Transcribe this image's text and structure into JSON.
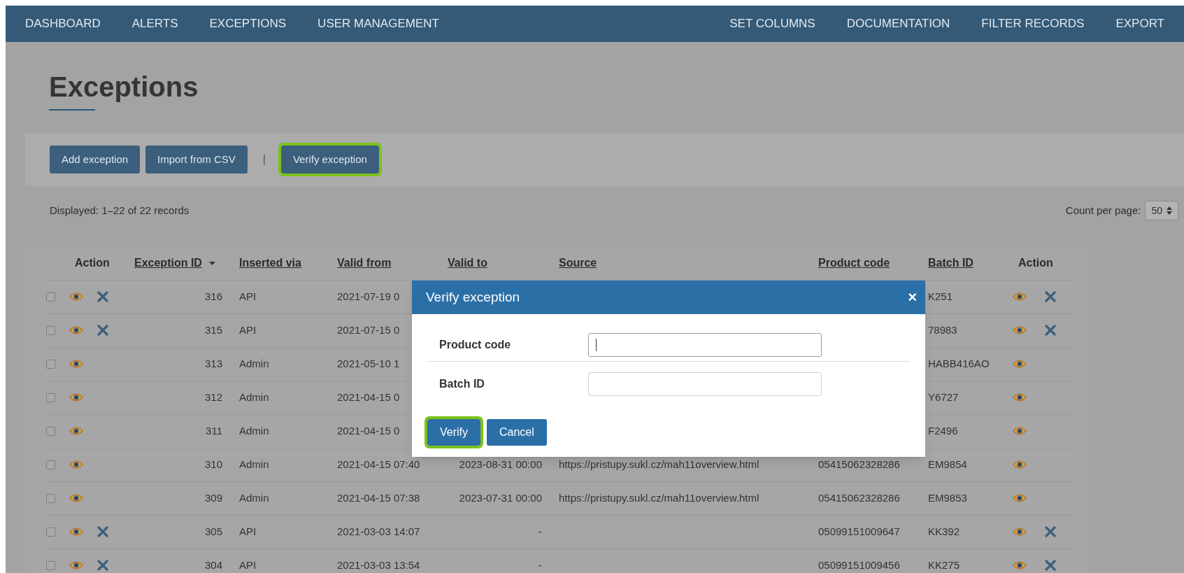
{
  "nav": {
    "left": [
      "DASHBOARD",
      "ALERTS",
      "EXCEPTIONS",
      "USER MANAGEMENT"
    ],
    "right": [
      "SET COLUMNS",
      "DOCUMENTATION",
      "FILTER RECORDS",
      "EXPORT"
    ]
  },
  "page_title": "Exceptions",
  "toolbar": {
    "items": [
      {
        "kind": "button",
        "label": "Add exception",
        "highlighted": false
      },
      {
        "kind": "button",
        "label": "Import from CSV",
        "highlighted": false
      },
      {
        "kind": "separator",
        "label": "|"
      },
      {
        "kind": "button",
        "label": "Verify exception",
        "highlighted": true
      }
    ]
  },
  "record_info": "Displayed: 1–22 of 22 records",
  "count_per_page": {
    "label": "Count per page:",
    "value": "50"
  },
  "table": {
    "columns": [
      {
        "label": "Action",
        "sortable": false,
        "sorted": false
      },
      {
        "label": "Exception ID",
        "sortable": true,
        "sorted": true
      },
      {
        "label": "Inserted via",
        "sortable": true,
        "sorted": false
      },
      {
        "label": "Valid from",
        "sortable": true,
        "sorted": false
      },
      {
        "label": "Valid to",
        "sortable": true,
        "sorted": false
      },
      {
        "label": "Source",
        "sortable": true,
        "sorted": false
      },
      {
        "label": "Product code",
        "sortable": true,
        "sorted": false
      },
      {
        "label": "Batch ID",
        "sortable": true,
        "sorted": false
      },
      {
        "label": "Action",
        "sortable": false,
        "sorted": false
      }
    ],
    "rows": [
      {
        "checked": false,
        "deletable": true,
        "id": "316",
        "inserted_via": "API",
        "valid_from": "2021-07-19 0",
        "batch_id": "K251"
      },
      {
        "checked": false,
        "deletable": true,
        "id": "315",
        "inserted_via": "API",
        "valid_from": "2021-07-15 0",
        "batch_id": "78983"
      },
      {
        "checked": false,
        "deletable": false,
        "id": "313",
        "inserted_via": "Admin",
        "valid_from": "2021-05-10 1",
        "batch_id": "HABB416AO"
      },
      {
        "checked": false,
        "deletable": false,
        "id": "312",
        "inserted_via": "Admin",
        "valid_from": "2021-04-15 0",
        "batch_id": "Y6727"
      },
      {
        "checked": false,
        "deletable": false,
        "id": "311",
        "inserted_via": "Admin",
        "valid_from": "2021-04-15 0",
        "batch_id": "F2496"
      },
      {
        "checked": false,
        "deletable": false,
        "id": "310",
        "inserted_via": "Admin",
        "valid_from": "2021-04-15 07:40",
        "valid_to": "2023-08-31 00:00",
        "source": "https://pristupy.sukl.cz/mah11overview.html",
        "product_code": "05415062328286",
        "batch_id": "EM9854"
      },
      {
        "checked": false,
        "deletable": false,
        "id": "309",
        "inserted_via": "Admin",
        "valid_from": "2021-04-15 07:38",
        "valid_to": "2023-07-31 00:00",
        "source": "https://pristupy.sukl.cz/mah11overview.html",
        "product_code": "05415062328286",
        "batch_id": "EM9853"
      },
      {
        "checked": false,
        "deletable": true,
        "id": "305",
        "inserted_via": "API",
        "valid_from": "2021-03-03 14:07",
        "valid_to": "-",
        "product_code": "05099151009647",
        "batch_id": "KK392"
      },
      {
        "checked": false,
        "deletable": true,
        "id": "304",
        "inserted_via": "API",
        "valid_from": "2021-03-03 13:54",
        "valid_to": "-",
        "product_code": "05099151009456",
        "batch_id": "KK275"
      }
    ]
  },
  "modal": {
    "title": "Verify exception",
    "close": "×",
    "fields": [
      {
        "label": "Product code",
        "focused": true
      },
      {
        "label": "Batch ID",
        "focused": false
      }
    ],
    "buttons": [
      {
        "label": "Verify",
        "highlighted": true
      },
      {
        "label": "Cancel",
        "highlighted": false
      }
    ]
  }
}
